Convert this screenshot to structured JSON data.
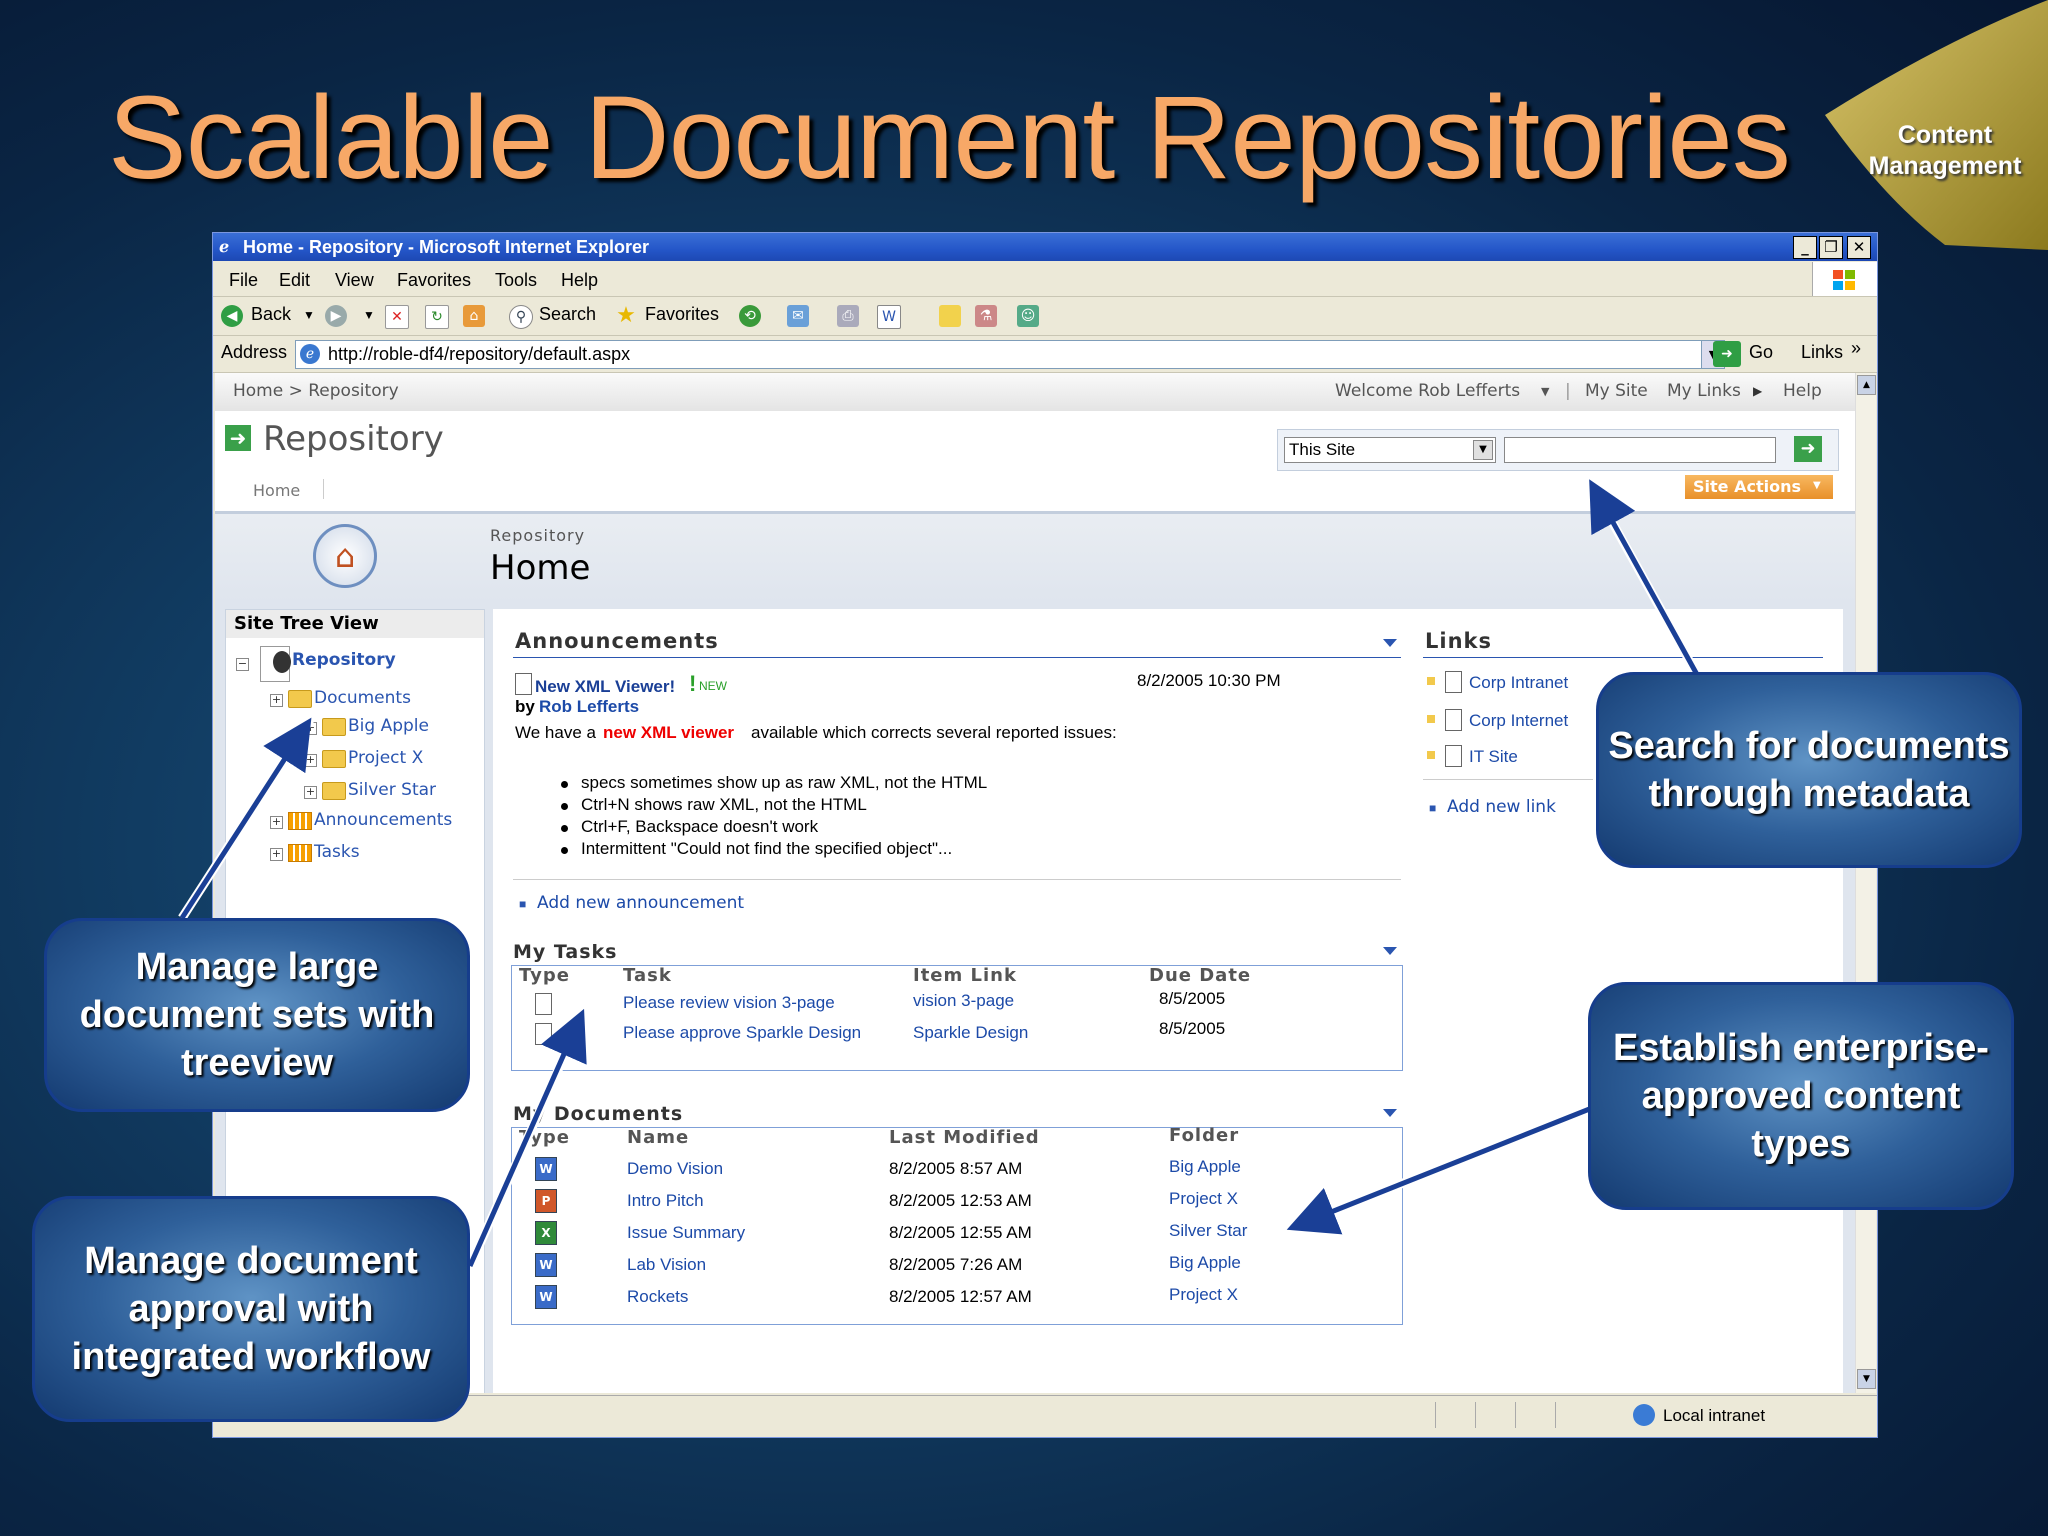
{
  "slide": {
    "title": "Scalable Document Repositories",
    "corner_badge": "Content Management"
  },
  "window": {
    "title": "Home - Repository - Microsoft Internet Explorer",
    "menu": [
      "File",
      "Edit",
      "View",
      "Favorites",
      "Tools",
      "Help"
    ],
    "toolbar": {
      "back": "Back",
      "search": "Search",
      "favorites": "Favorites"
    },
    "address_label": "Address",
    "address_value": "http://roble-df4/repository/default.aspx",
    "go_label": "Go",
    "links_label": "Links",
    "status_zone": "Local intranet"
  },
  "site": {
    "breadcrumb": "Home > Repository",
    "welcome": "Welcome Rob Lefferts",
    "my_site": "My Site",
    "my_links": "My Links",
    "help": "Help",
    "title": "Repository",
    "tab_home": "Home",
    "search_scope": "This Site",
    "site_actions": "Site Actions",
    "page_crumb": "Repository",
    "page_title": "Home"
  },
  "tree": {
    "heading": "Site Tree View",
    "root": "Repository",
    "items": [
      "Documents",
      "Big Apple",
      "Project X",
      "Silver Star",
      "Announcements",
      "Tasks"
    ]
  },
  "announcements": {
    "heading": "Announcements",
    "item_title": "New XML Viewer!",
    "new_badge": "NEW",
    "date": "8/2/2005 10:30 PM",
    "by_label": "by",
    "author": "Rob Lefferts",
    "body_before": "We have a",
    "body_highlight": "new XML viewer",
    "body_after": "available which corrects several reported issues:",
    "bullets": [
      "specs sometimes show up as raw XML, not the HTML",
      "Ctrl+N shows raw XML, not the HTML",
      "Ctrl+F, Backspace doesn't work",
      "Intermittent \"Could not find the specified object\"..."
    ],
    "add_link": "Add new announcement"
  },
  "links": {
    "heading": "Links",
    "items": [
      "Corp Intranet",
      "Corp Internet",
      "IT Site"
    ],
    "add_link": "Add new link"
  },
  "tasks": {
    "heading": "My Tasks",
    "columns": [
      "Type",
      "Task",
      "Item Link",
      "Due Date"
    ],
    "rows": [
      {
        "task": "Please review vision 3-page",
        "link": "vision 3-page",
        "due": "8/5/2005"
      },
      {
        "task": "Please approve Sparkle Design",
        "link": "Sparkle Design",
        "due": "8/5/2005"
      }
    ]
  },
  "documents": {
    "heading": "My Documents",
    "columns": [
      "Type",
      "Name",
      "Last Modified",
      "Folder"
    ],
    "rows": [
      {
        "type": "W",
        "name": "Demo Vision",
        "modified": "8/2/2005 8:57 AM",
        "folder": "Big Apple"
      },
      {
        "type": "P",
        "name": "Intro Pitch",
        "modified": "8/2/2005 12:53 AM",
        "folder": "Project X"
      },
      {
        "type": "X",
        "name": "Issue Summary",
        "modified": "8/2/2005 12:55 AM",
        "folder": "Silver Star"
      },
      {
        "type": "W",
        "name": "Lab Vision",
        "modified": "8/2/2005 7:26 AM",
        "folder": "Big Apple"
      },
      {
        "type": "W",
        "name": "Rockets",
        "modified": "8/2/2005 12:57 AM",
        "folder": "Project X"
      }
    ]
  },
  "callouts": {
    "search": "Search for documents through metadata",
    "treeview": "Manage large document sets with treeview",
    "workflow": "Manage document approval with integrated workflow",
    "content_types": "Establish enterprise-approved content types"
  },
  "colors": {
    "title": "#f7a867",
    "link": "#1c4aa8",
    "site_actions": "#f0a040",
    "callout_border": "#163d8c"
  }
}
